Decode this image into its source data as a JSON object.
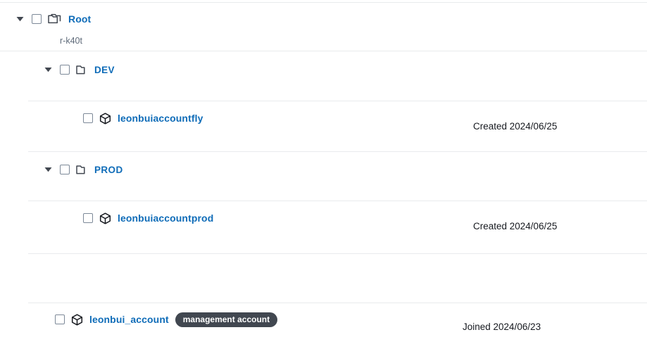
{
  "tree": {
    "root": {
      "label": "Root",
      "id": "r-k40t",
      "caret_icon": "caret-down-icon",
      "folder_icon": "folders-icon"
    },
    "organizational_units": [
      {
        "label": "DEV",
        "caret_icon": "caret-down-icon",
        "folder_icon": "folder-icon",
        "accounts": [
          {
            "name": "leonbuiaccountfly",
            "account_icon": "cube-icon",
            "meta": "Created 2024/06/25"
          }
        ]
      },
      {
        "label": "PROD",
        "caret_icon": "caret-down-icon",
        "folder_icon": "folder-icon",
        "accounts": [
          {
            "name": "leonbuiaccountprod",
            "account_icon": "cube-icon",
            "meta": "Created 2024/06/25"
          }
        ]
      }
    ],
    "management_account": {
      "name": "leonbui_account",
      "badge": "management account",
      "account_icon": "cube-icon",
      "meta": "Joined 2024/06/23"
    }
  },
  "colors": {
    "link": "#0f6cb8",
    "badge_background": "#414750",
    "divider": "#e9ebed",
    "muted_text": "#5f6b7a"
  }
}
